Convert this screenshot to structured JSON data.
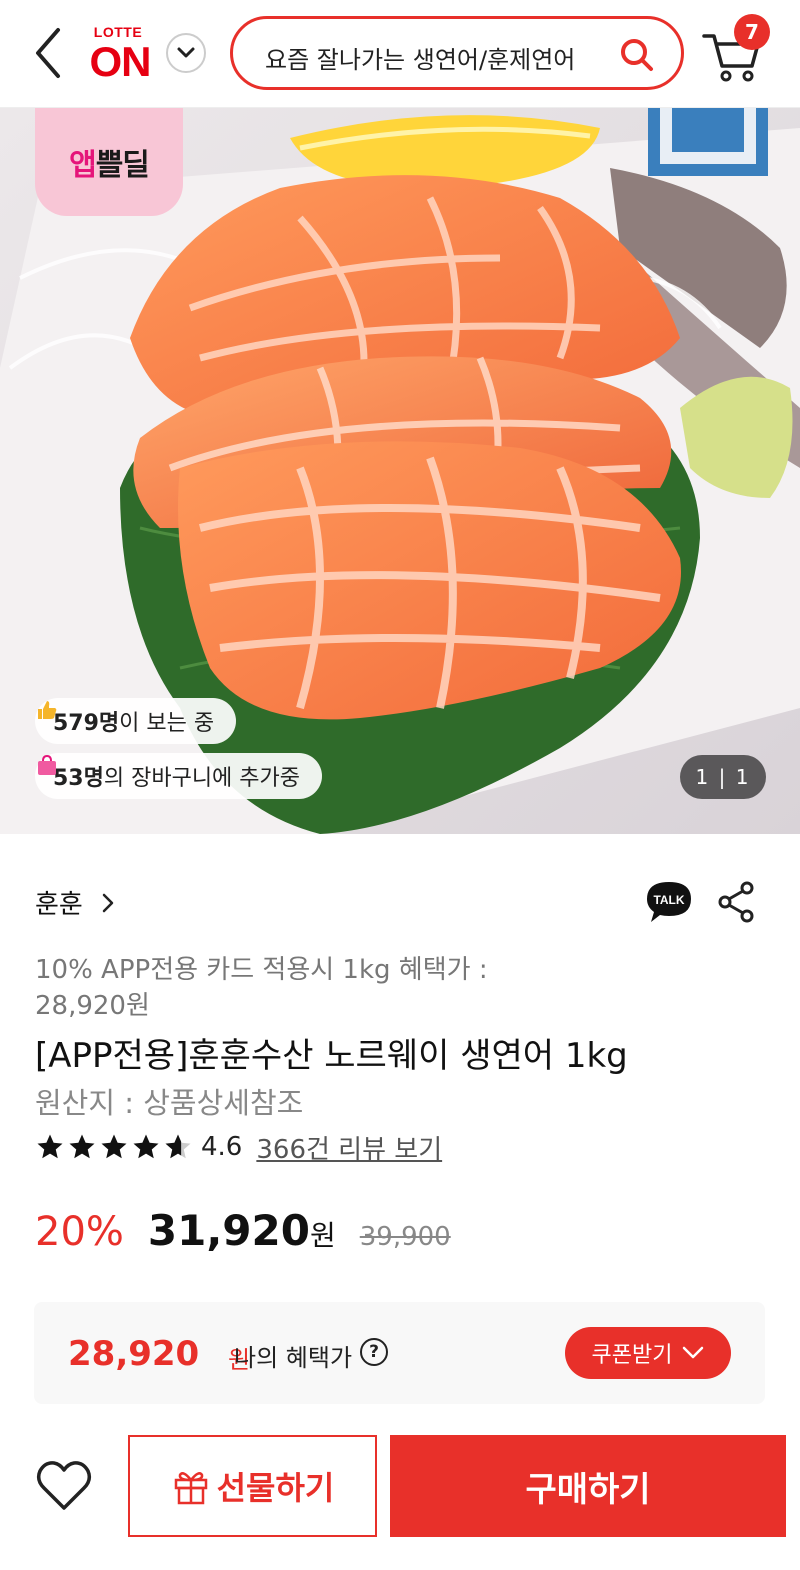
{
  "header": {
    "logo_top": "LOTTE",
    "logo_main": "ON",
    "search_text": "요즘 잘나가는 생연어/훈제연어",
    "cart_count": "7"
  },
  "hero": {
    "badge_prefix": "앱",
    "badge_suffix": "쁠딜",
    "viewers_count": "579명",
    "viewers_text": "이 보는 중",
    "cart_added_count": "53명",
    "cart_added_text": "의 장바구니에 추가중",
    "image_counter": "1 | 1"
  },
  "product": {
    "seller": "훈훈",
    "benefit_note": "10% APP전용 카드 적용시 1kg 혜택가 : 28,920원",
    "title": "[APP전용]훈훈수산 노르웨이 생연어 1kg",
    "origin": "원산지 : 상품상세참조",
    "rating": 4.6,
    "rating_text": "4.6",
    "review_link": "366건 리뷰 보기",
    "discount": "20%",
    "price": "31,920",
    "price_unit": "원",
    "original_price": "39,900"
  },
  "benefit_box": {
    "price": "28,920",
    "unit": "원",
    "label": "나의 혜택가",
    "help": "?",
    "coupon_button": "쿠폰받기"
  },
  "bottom_bar": {
    "gift_button": "선물하기",
    "buy_button": "구매하기"
  },
  "colors": {
    "brand_red": "#e8302a",
    "badge_pink": "#f8c6d6"
  }
}
